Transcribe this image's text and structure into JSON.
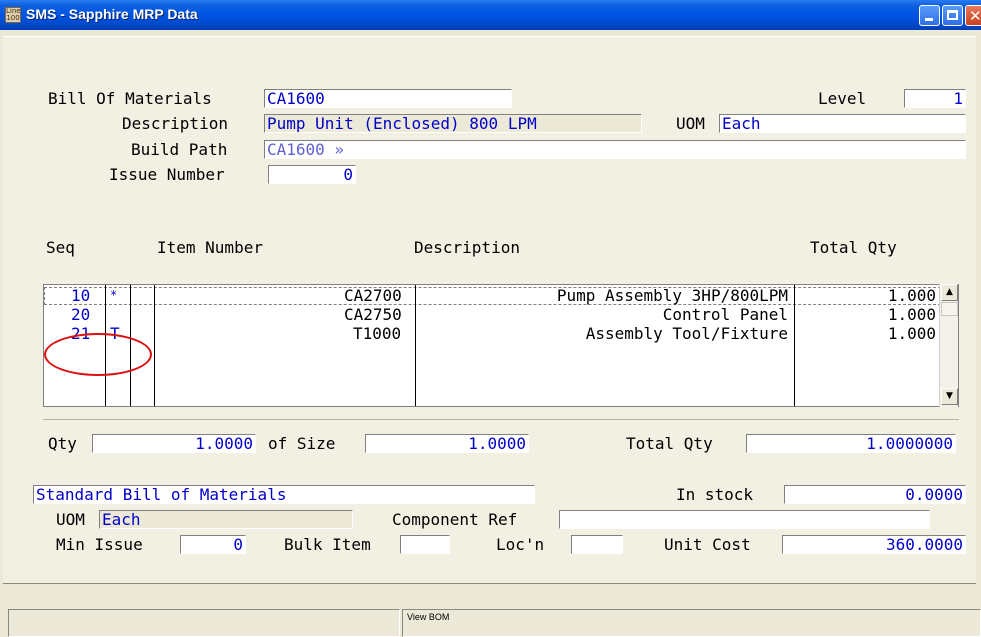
{
  "window": {
    "title": "SMS - Sapphire MRP Data",
    "icon_text": "Line 100"
  },
  "header": {
    "bom_label": "Bill Of Materials",
    "bom_value": "CA1600",
    "level_label": "Level",
    "level_value": "1",
    "description_label": "Description",
    "description_value": "Pump Unit (Enclosed) 800 LPM",
    "uom_label": "UOM",
    "uom_value": "Each",
    "build_path_label": "Build Path",
    "build_path_value": "CA1600 »",
    "issue_label": "Issue Number",
    "issue_value": "0"
  },
  "grid": {
    "columns": [
      "Seq",
      "Item Number",
      "Description",
      "Total Qty"
    ],
    "rows": [
      {
        "seq": "10",
        "flag": "*",
        "item": "CA2700",
        "description": "Pump Assembly 3HP/800LPM",
        "qty": "1.000"
      },
      {
        "seq": "20",
        "flag": "",
        "item": "CA2750",
        "description": "Control Panel",
        "qty": "1.000"
      },
      {
        "seq": "21",
        "flag": "T",
        "item": "T1000",
        "description": "Assembly Tool/Fixture",
        "qty": "1.000"
      }
    ]
  },
  "qty_line": {
    "qty_label": "Qty",
    "qty_value": "1.0000",
    "size_label": "of Size",
    "size_value": "1.0000",
    "total_label": "Total Qty",
    "total_value": "1.0000000"
  },
  "detail": {
    "bom_type": "Standard Bill of Materials",
    "in_stock_label": "In stock",
    "in_stock_value": "0.0000",
    "uom_label": "UOM",
    "uom_value": "Each",
    "component_ref_label": "Component Ref",
    "component_ref_value": "",
    "min_issue_label": "Min Issue",
    "min_issue_value": "0",
    "bulk_item_label": "Bulk Item",
    "bulk_item_value": "",
    "locn_label": "Loc'n",
    "locn_value": "",
    "unit_cost_label": "Unit Cost",
    "unit_cost_value": "360.0000"
  },
  "status_bar": {
    "pane1": "",
    "pane2": "View BOM"
  },
  "colors": {
    "title_bar": "#0054e3",
    "field_text": "#0000c8",
    "annotation_circle": "#dd1010"
  }
}
